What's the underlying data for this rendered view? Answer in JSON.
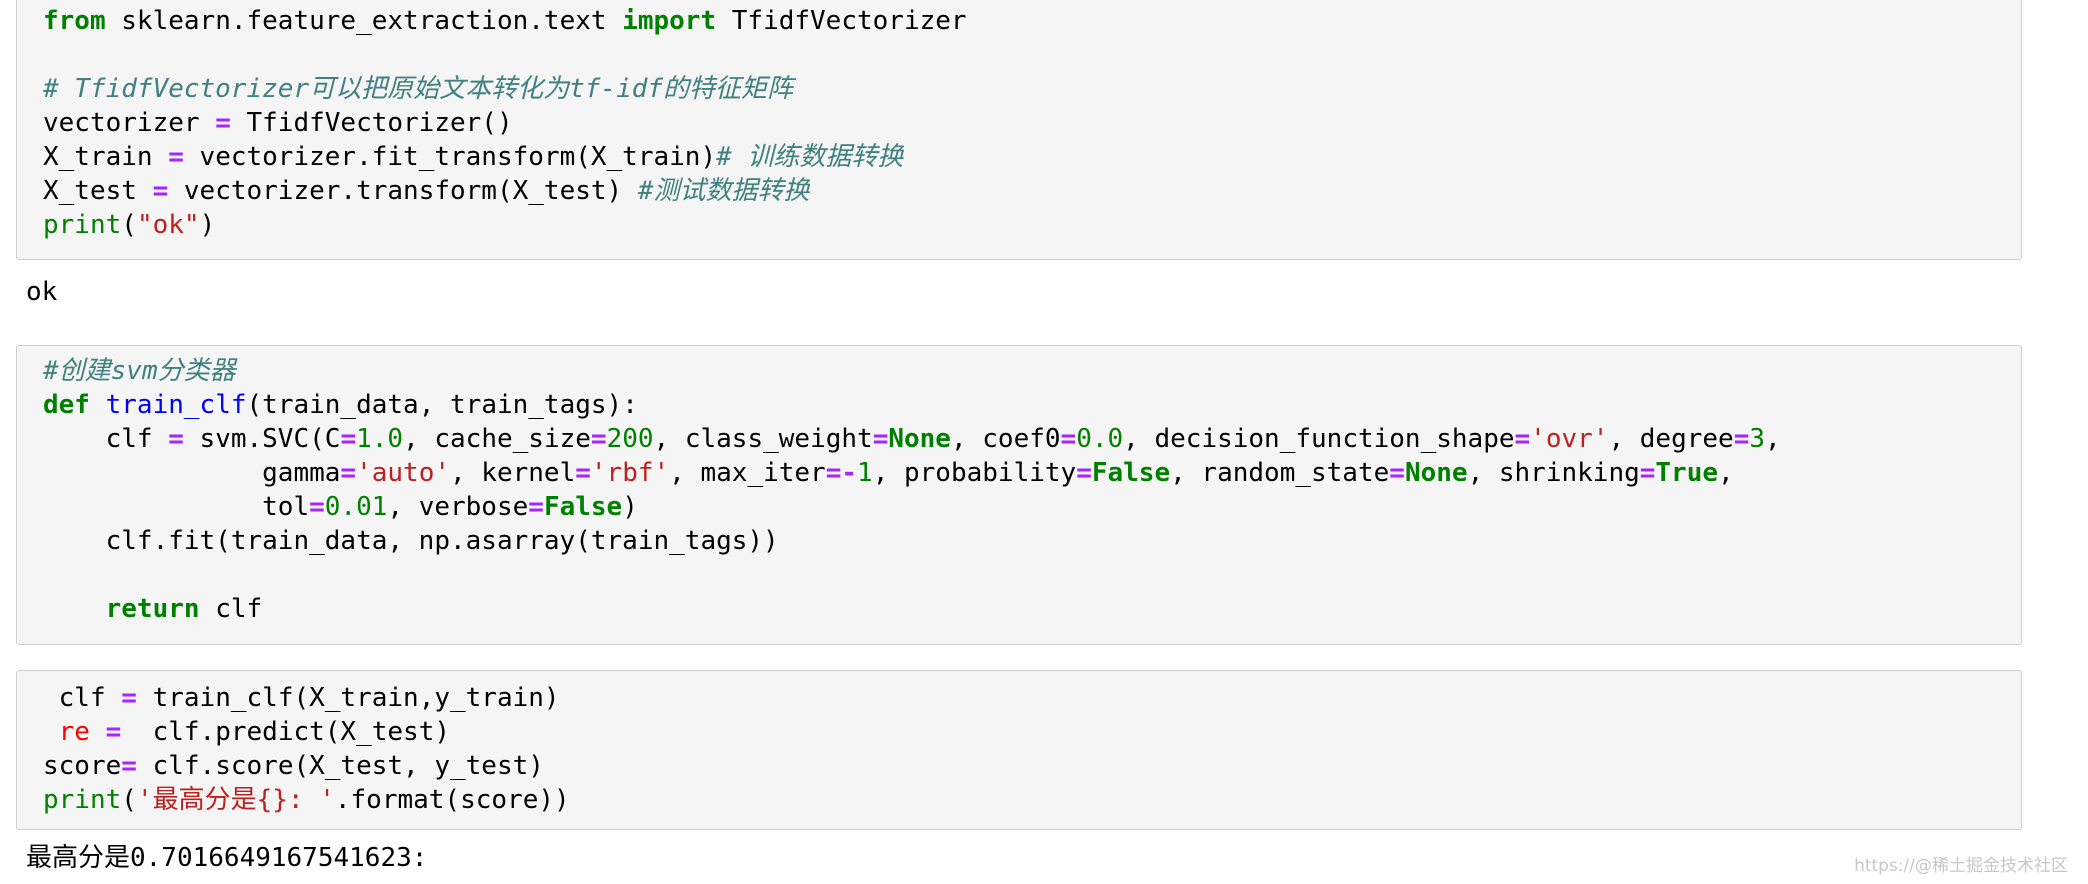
{
  "cells": [
    {
      "input_lines": [
        [
          {
            "t": "from",
            "c": "kw"
          },
          {
            "t": " sklearn.feature_extraction.text "
          },
          {
            "t": "import",
            "c": "kw"
          },
          {
            "t": " TfidfVectorizer"
          }
        ],
        [],
        [
          {
            "t": "# TfidfVectorizer可以把原始文本转化为tf-idf的特征矩阵",
            "c": "cm"
          }
        ],
        [
          {
            "t": "vectorizer "
          },
          {
            "t": "=",
            "c": "op"
          },
          {
            "t": " TfidfVectorizer()"
          }
        ],
        [
          {
            "t": "X_train "
          },
          {
            "t": "=",
            "c": "op"
          },
          {
            "t": " vectorizer.fit_transform(X_train)"
          },
          {
            "t": "# 训练数据转换",
            "c": "cm"
          }
        ],
        [
          {
            "t": "X_test "
          },
          {
            "t": "=",
            "c": "op"
          },
          {
            "t": " vectorizer.transform(X_test) "
          },
          {
            "t": "#测试数据转换",
            "c": "cm"
          }
        ],
        [
          {
            "t": "print",
            "c": "bi"
          },
          {
            "t": "("
          },
          {
            "t": "\"ok\"",
            "c": "str"
          },
          {
            "t": ")"
          }
        ]
      ],
      "output": "ok"
    },
    {
      "input_lines": [
        [
          {
            "t": "#创建svm分类器",
            "c": "cm"
          }
        ],
        [
          {
            "t": "def",
            "c": "kw"
          },
          {
            "t": " "
          },
          {
            "t": "train_clf",
            "c": "fn"
          },
          {
            "t": "(train_data, train_tags):"
          }
        ],
        [
          {
            "t": "    clf "
          },
          {
            "t": "=",
            "c": "op"
          },
          {
            "t": " svm.SVC(C"
          },
          {
            "t": "=",
            "c": "op"
          },
          {
            "t": "1.0",
            "c": "num"
          },
          {
            "t": ", cache_size"
          },
          {
            "t": "=",
            "c": "op"
          },
          {
            "t": "200",
            "c": "num"
          },
          {
            "t": ", class_weight"
          },
          {
            "t": "=",
            "c": "op"
          },
          {
            "t": "None",
            "c": "kw"
          },
          {
            "t": ", coef0"
          },
          {
            "t": "=",
            "c": "op"
          },
          {
            "t": "0.0",
            "c": "num"
          },
          {
            "t": ", decision_function_shape"
          },
          {
            "t": "=",
            "c": "op"
          },
          {
            "t": "'ovr'",
            "c": "str"
          },
          {
            "t": ", degree"
          },
          {
            "t": "=",
            "c": "op"
          },
          {
            "t": "3",
            "c": "num"
          },
          {
            "t": ","
          }
        ],
        [
          {
            "t": "              gamma"
          },
          {
            "t": "=",
            "c": "op"
          },
          {
            "t": "'auto'",
            "c": "str"
          },
          {
            "t": ", kernel"
          },
          {
            "t": "=",
            "c": "op"
          },
          {
            "t": "'rbf'",
            "c": "str"
          },
          {
            "t": ", max_iter"
          },
          {
            "t": "=-",
            "c": "op"
          },
          {
            "t": "1",
            "c": "num"
          },
          {
            "t": ", probability"
          },
          {
            "t": "=",
            "c": "op"
          },
          {
            "t": "False",
            "c": "kw"
          },
          {
            "t": ", random_state"
          },
          {
            "t": "=",
            "c": "op"
          },
          {
            "t": "None",
            "c": "kw"
          },
          {
            "t": ", shrinking"
          },
          {
            "t": "=",
            "c": "op"
          },
          {
            "t": "True",
            "c": "kw"
          },
          {
            "t": ","
          }
        ],
        [
          {
            "t": "              tol"
          },
          {
            "t": "=",
            "c": "op"
          },
          {
            "t": "0.01",
            "c": "num"
          },
          {
            "t": ", verbose"
          },
          {
            "t": "=",
            "c": "op"
          },
          {
            "t": "False",
            "c": "kw"
          },
          {
            "t": ")"
          }
        ],
        [
          {
            "t": "    clf.fit(train_data, np.asarray(train_tags))"
          }
        ],
        [],
        [
          {
            "t": "    "
          },
          {
            "t": "return",
            "c": "kw"
          },
          {
            "t": " clf"
          }
        ]
      ]
    },
    {
      "input_lines": [
        [
          {
            "t": " clf "
          },
          {
            "t": "=",
            "c": "op"
          },
          {
            "t": " train_clf(X_train,y_train)"
          }
        ],
        [
          {
            "t": " "
          },
          {
            "t": "re",
            "c": "err"
          },
          {
            "t": " "
          },
          {
            "t": "=",
            "c": "op"
          },
          {
            "t": "  clf.predict(X_test)"
          }
        ],
        [
          {
            "t": "score"
          },
          {
            "t": "=",
            "c": "op"
          },
          {
            "t": " clf.score(X_test, y_test)"
          }
        ],
        [
          {
            "t": "print",
            "c": "bi"
          },
          {
            "t": "("
          },
          {
            "t": "'最高分是{}: '",
            "c": "str"
          },
          {
            "t": ".format(score))"
          }
        ]
      ],
      "output": "最高分是0.7016649167541623:"
    }
  ],
  "watermark": "https://@稀土掘金技术社区"
}
